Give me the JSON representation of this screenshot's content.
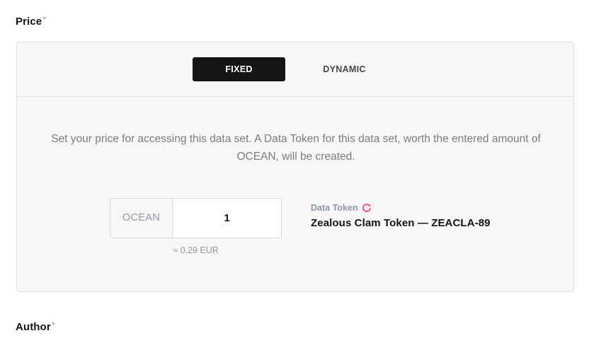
{
  "price": {
    "label": "Price",
    "required_mark": "*",
    "tabs": [
      {
        "label": "FIXED",
        "active": true
      },
      {
        "label": "DYNAMIC",
        "active": false
      }
    ],
    "description": "Set your price for accessing this data set. A Data Token for this data set, worth the entered amount of OCEAN, will be created.",
    "currency": "OCEAN",
    "amount": "1",
    "conversion": "≈ 0.29 EUR",
    "data_token": {
      "title": "Data Token",
      "name": "Zealous Clam Token — ZEACLA-89",
      "refresh_icon": "refresh-icon"
    }
  },
  "author": {
    "label": "Author",
    "required_mark": "*"
  },
  "colors": {
    "active_tab_bg": "#141414",
    "refresh_accent": "#ff4092",
    "muted_text": "#8b98a9"
  }
}
